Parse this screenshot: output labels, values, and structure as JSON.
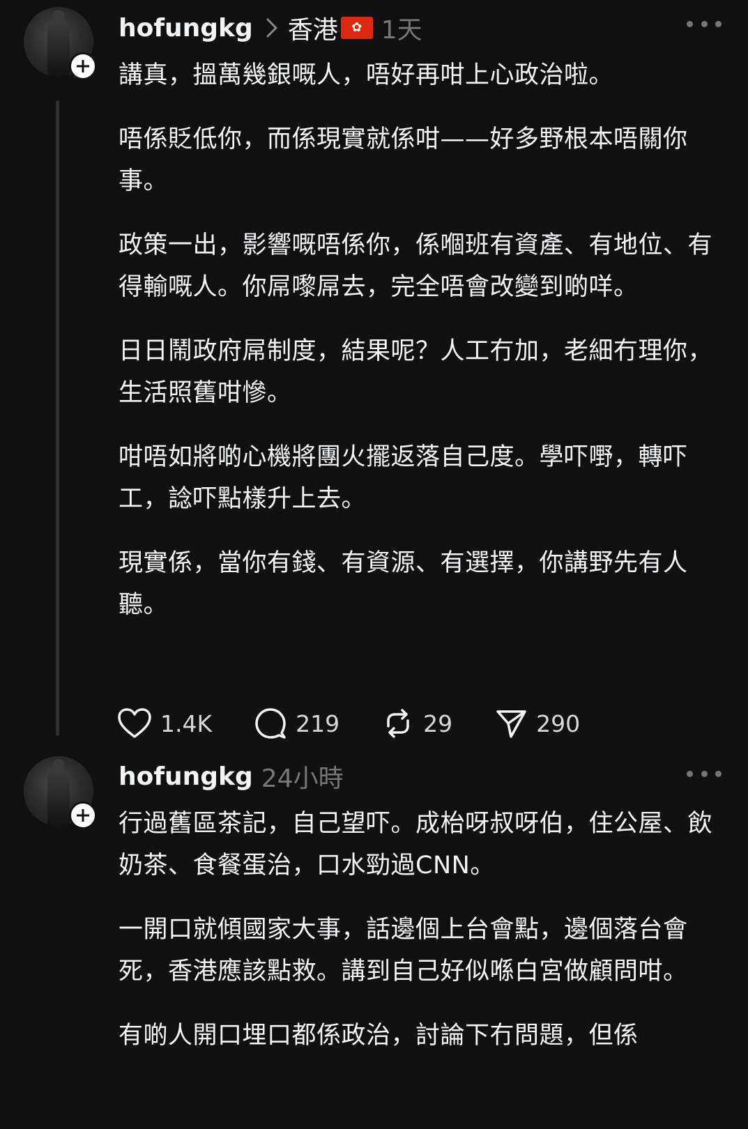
{
  "colors": {
    "background": "#101010",
    "text": "#f3f5f7",
    "muted": "#777777",
    "flag_red": "#de2910"
  },
  "post1": {
    "username": "hofungkg",
    "location": "香港",
    "flag_icon": "hong-kong-flag-icon",
    "time": "1天",
    "paragraphs": [
      "講真，搵萬幾銀嘅人，唔好再咁上心政治啦。",
      "唔係貶低你，而係現實就係咁——好多野根本唔關你事。",
      "政策一出，影響嘅唔係你，係嗰班有資產、有地位、有得輸嘅人。你屌嚟屌去，完全唔會改變到啲咩。",
      "日日鬧政府屌制度，結果呢？人工冇加，老細冇理你，生活照舊咁慘。",
      "咁唔如將啲心機將團火擺返落自己度。學吓嘢，轉吓工，諗吓點樣升上去。",
      "現實係，當你有錢、有資源、有選擇，你講野先有人聽。"
    ],
    "actions": {
      "likes": "1.4K",
      "replies": "219",
      "reposts": "29",
      "shares": "290"
    }
  },
  "post2": {
    "username": "hofungkg",
    "time": "24小時",
    "paragraphs": [
      "行過舊區茶記，自己望吓。成枱呀叔呀伯，住公屋、飲奶茶、食餐蛋治，口水勁過CNN。",
      "一開口就傾國家大事，話邊個上台會點，邊個落台會死，香港應該點救。講到自己好似喺白宮做顧問咁。",
      "有啲人開口埋口都係政治，討論下冇問題，但係"
    ]
  }
}
